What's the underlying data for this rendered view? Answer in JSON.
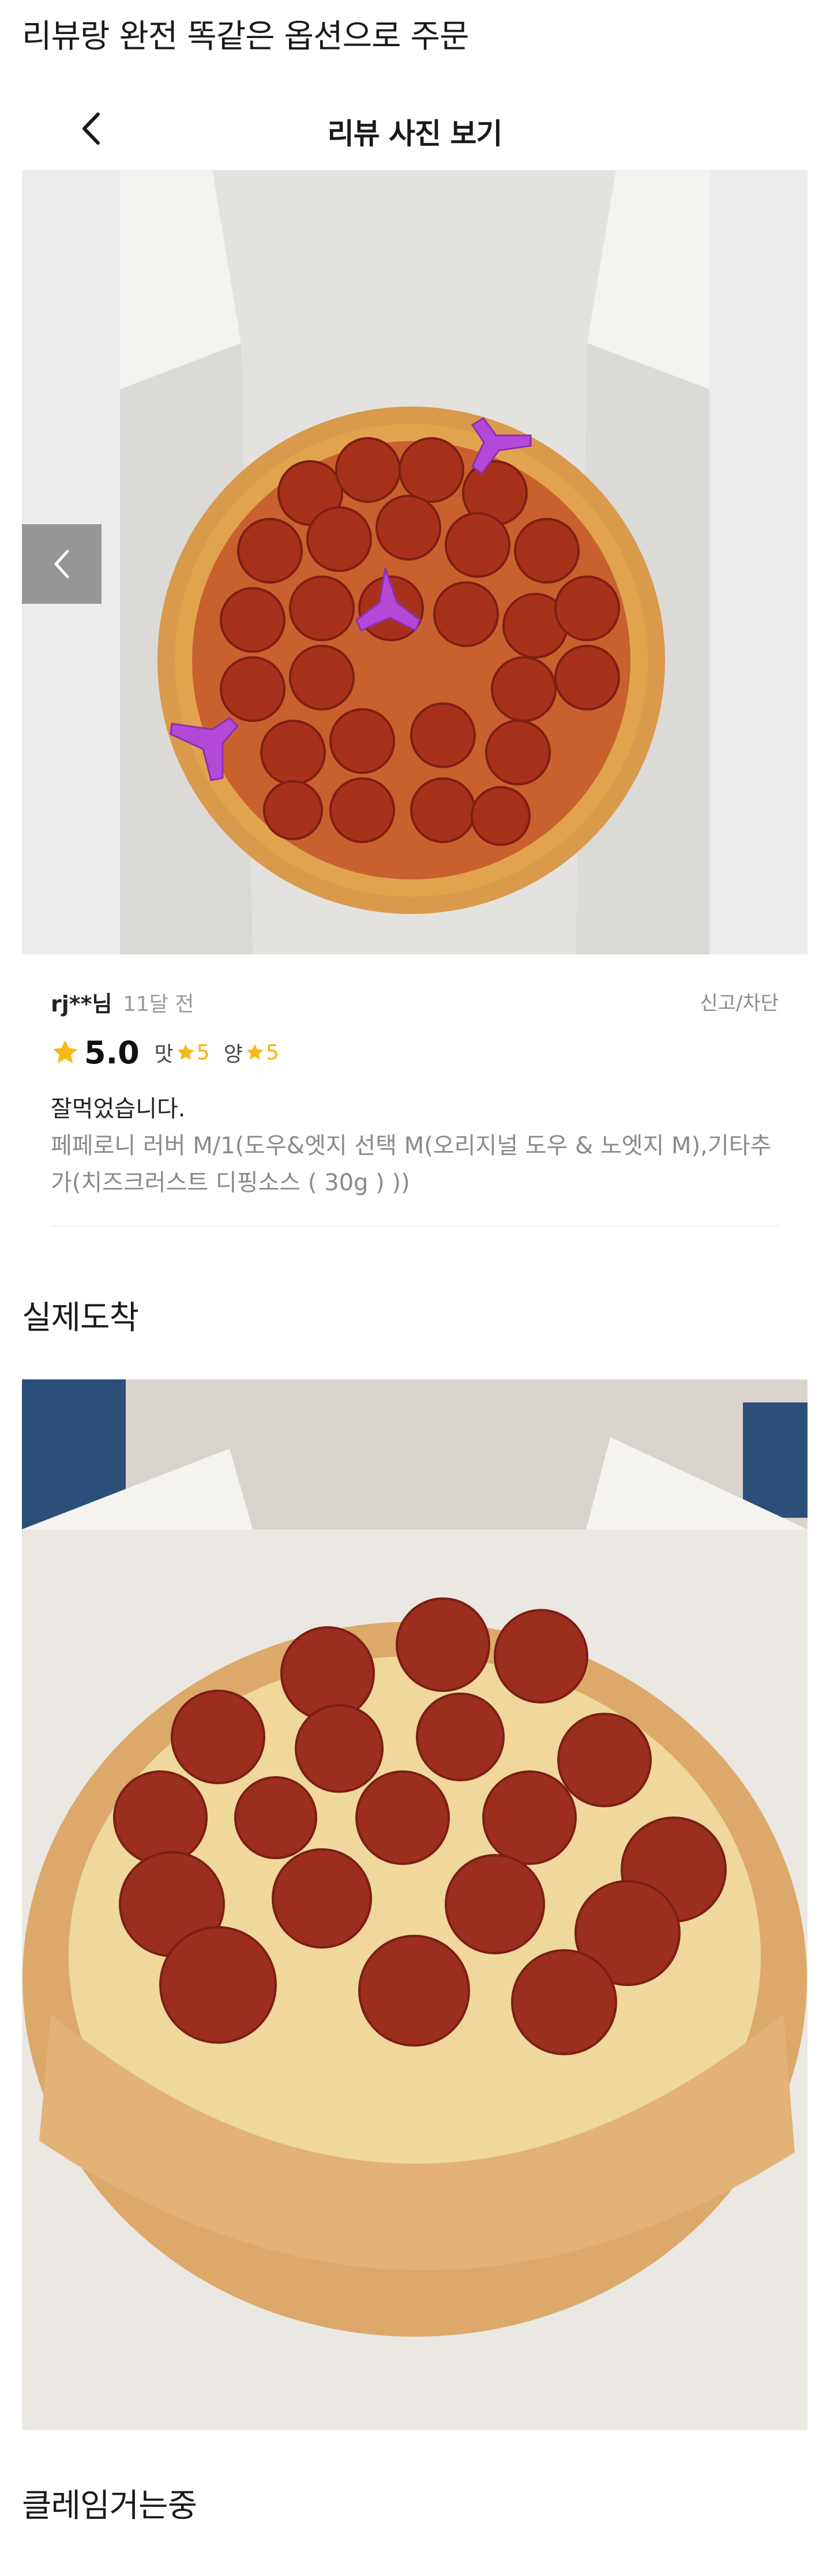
{
  "post": {
    "title": "리뷰랑 완전 똑같은 옵션으로 주문"
  },
  "review_screen": {
    "header_title": "리뷰 사진 보기",
    "icons": {
      "back": "chevron-left-icon",
      "carousel_prev": "chevron-left-icon",
      "star": "star-icon"
    },
    "reviewer_name": "rj**님",
    "date": "11달 전",
    "report_label": "신고/차단",
    "rating": "5.0",
    "taste_label": "맛",
    "taste_score": "5",
    "quantity_label": "양",
    "quantity_score": "5",
    "text": "잘먹었습니다.",
    "order_options": "페페로니 러버 M/1(도우&엣지 선택 M(오리지널 도우 & 노엣지 M),기타추가(치즈크러스트 디핑소스 ( 30g ) ))"
  },
  "sections": {
    "arrival_title": "실제도착",
    "claim_title": "클레임거는중"
  },
  "colors": {
    "star": "#f6b81c",
    "sub_score": "#f4b400",
    "meta_gray": "#9a9a9a",
    "option_gray": "#8a8a8a"
  }
}
